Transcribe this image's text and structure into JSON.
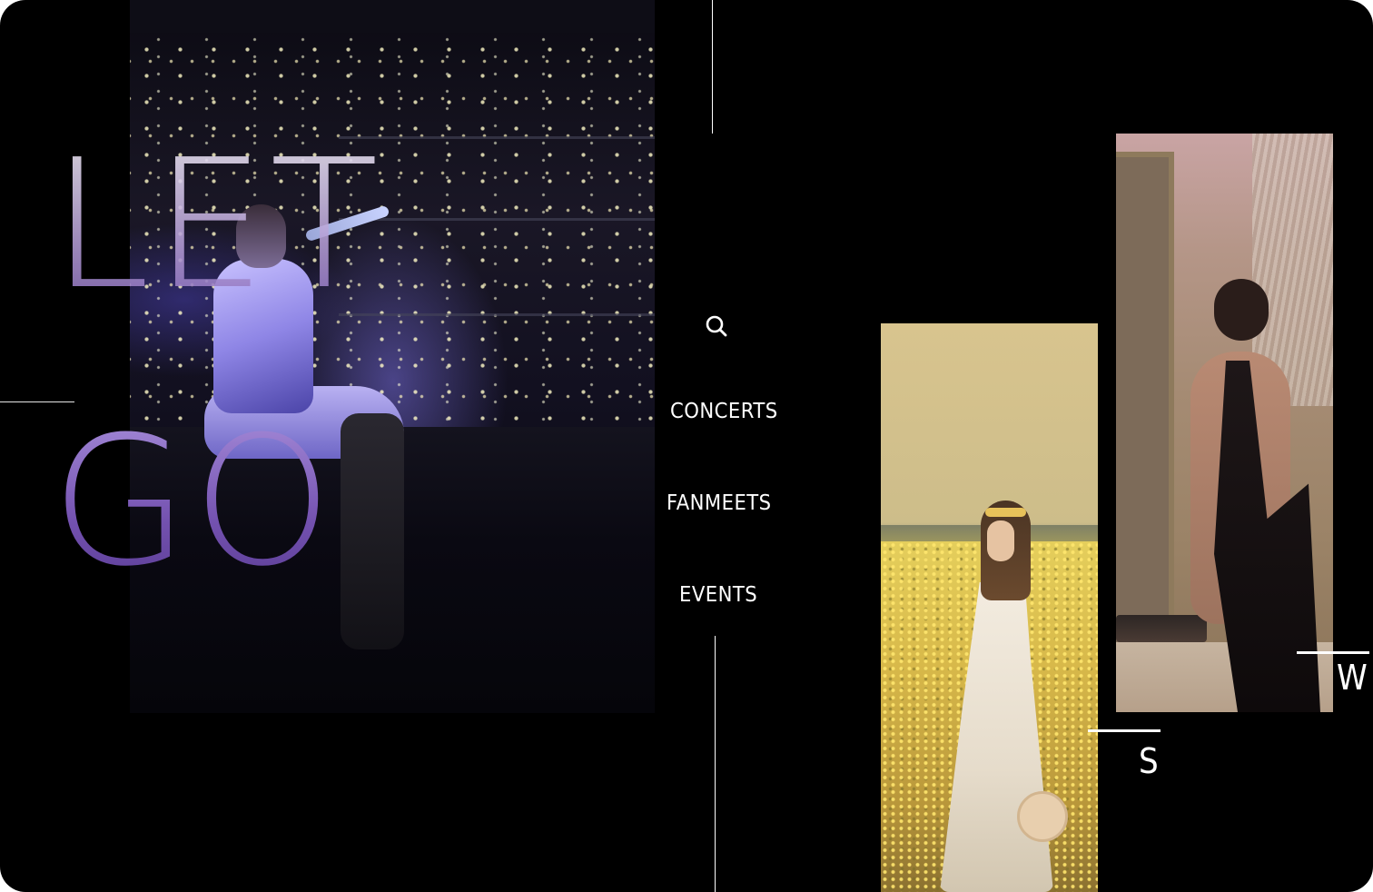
{
  "hero": {
    "line1": "LET",
    "line2": "GO"
  },
  "nav": {
    "search_icon": "search-icon",
    "items": [
      {
        "label": "CONCERTS"
      },
      {
        "label": "FANMEETS"
      },
      {
        "label": "EVENTS"
      }
    ]
  },
  "gallery": {
    "cards": [
      {
        "label": "S"
      },
      {
        "label": "W"
      }
    ]
  },
  "colors": {
    "background": "#000000",
    "text": "#ffffff",
    "hero_gradient_top": "#f3eef9",
    "hero_gradient_bottom": "#7452b0"
  }
}
